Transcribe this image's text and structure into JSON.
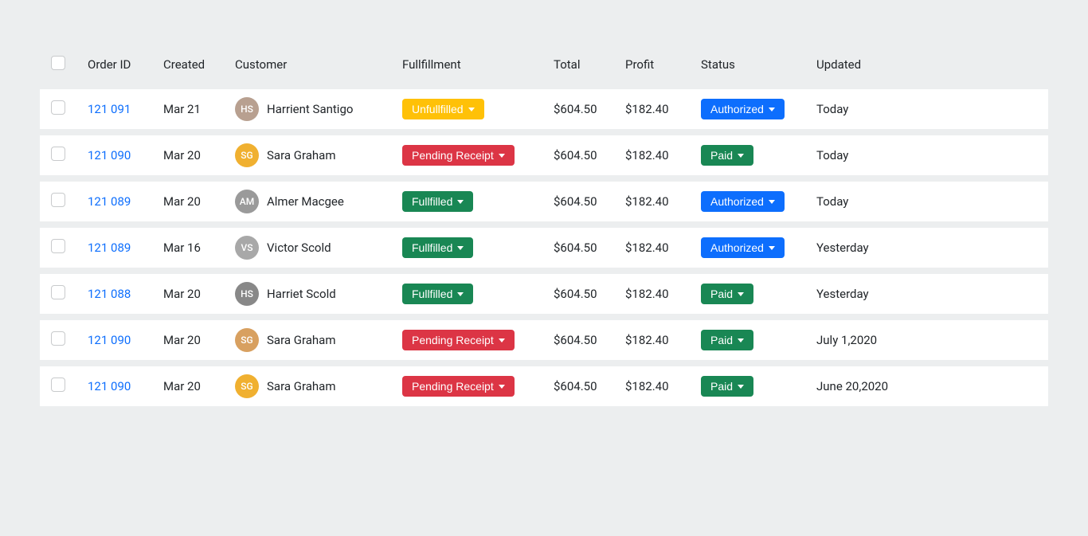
{
  "columns": {
    "checkbox": "",
    "order_id": "Order ID",
    "created": "Created",
    "customer": "Customer",
    "fulfillment": "Fullfillment",
    "total": "Total",
    "profit": "Profit",
    "status": "Status",
    "updated": "Updated"
  },
  "fulfillment_colors": {
    "Unfullfilled": "btn-warning",
    "Pending Receipt": "btn-danger",
    "Fullfilled": "btn-success"
  },
  "status_colors": {
    "Authorized": "btn-primary",
    "Paid": "btn-success"
  },
  "avatar_colors": [
    "#b8a090",
    "#f0b030",
    "#9a9a9a",
    "#a8a8a8",
    "#888888",
    "#d8a060",
    "#f0b030"
  ],
  "rows": [
    {
      "order_id": "121 091",
      "created": "Mar 21",
      "customer": "Harrient Santigo",
      "fulfillment": "Unfullfilled",
      "total": "$604.50",
      "profit": "$182.40",
      "status": "Authorized",
      "updated": "Today"
    },
    {
      "order_id": "121 090",
      "created": "Mar 20",
      "customer": "Sara Graham",
      "fulfillment": "Pending Receipt",
      "total": "$604.50",
      "profit": "$182.40",
      "status": "Paid",
      "updated": "Today"
    },
    {
      "order_id": "121 089",
      "created": "Mar 20",
      "customer": "Almer Macgee",
      "fulfillment": "Fullfilled",
      "total": "$604.50",
      "profit": "$182.40",
      "status": "Authorized",
      "updated": "Today"
    },
    {
      "order_id": "121 089",
      "created": "Mar 16",
      "customer": "Victor Scold",
      "fulfillment": "Fullfilled",
      "total": "$604.50",
      "profit": "$182.40",
      "status": "Authorized",
      "updated": "Yesterday"
    },
    {
      "order_id": "121 088",
      "created": "Mar 20",
      "customer": "Harriet Scold",
      "fulfillment": "Fullfilled",
      "total": "$604.50",
      "profit": "$182.40",
      "status": "Paid",
      "updated": "Yesterday"
    },
    {
      "order_id": "121 090",
      "created": "Mar 20",
      "customer": "Sara Graham",
      "fulfillment": "Pending Receipt",
      "total": "$604.50",
      "profit": "$182.40",
      "status": "Paid",
      "updated": "July 1,2020"
    },
    {
      "order_id": "121 090",
      "created": "Mar 20",
      "customer": "Sara Graham",
      "fulfillment": "Pending Receipt",
      "total": "$604.50",
      "profit": "$182.40",
      "status": "Paid",
      "updated": "June 20,2020"
    }
  ]
}
